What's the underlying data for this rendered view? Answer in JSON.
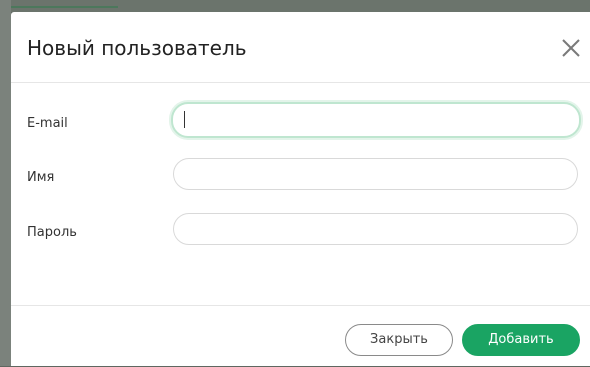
{
  "dialog": {
    "title": "Новый пользователь",
    "close_icon": "close-icon"
  },
  "form": {
    "fields": [
      {
        "label": "E-mail",
        "value": "",
        "placeholder": "",
        "focused": true
      },
      {
        "label": "Имя",
        "value": "",
        "placeholder": ""
      },
      {
        "label": "Пароль",
        "value": "",
        "placeholder": ""
      }
    ]
  },
  "footer": {
    "close_label": "Закрыть",
    "add_label": "Добавить"
  },
  "colors": {
    "accent": "#1aa463",
    "focus_ring": "#bfe6d0"
  }
}
